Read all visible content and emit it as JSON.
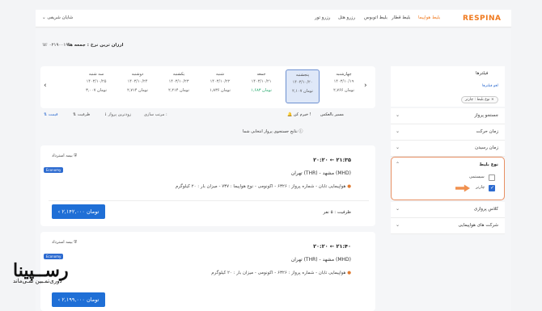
{
  "header": {
    "logo": "RESPINA",
    "nav": [
      "بلیط هواپیما",
      "بلیط قطار",
      "بلیط اتوبوس",
      "رزرو هتل",
      "رزرو تور"
    ],
    "user": "شایان شریفی"
  },
  "route_bar": {
    "title": "ارزان ترین نرخ : جمعه ها",
    "phone": "۰۲۱۹۰۰۱۹۰۰"
  },
  "dates": [
    {
      "day": "چهارشنبه",
      "date": "۱۴۰۳/۱۰/۱۹",
      "price": "۲,۷۶۶ تومان",
      "selected": false,
      "green": false
    },
    {
      "day": "پنجشنبه",
      "date": "۱۴۰۳/۱۰/۲۰",
      "price": "۲,۱۰۷ تومان",
      "selected": true,
      "green": false
    },
    {
      "day": "جمعه",
      "date": "۱۴۰۳/۱۰/۲۱",
      "price": "۱,۶۸۳ تومان",
      "selected": false,
      "green": true
    },
    {
      "day": "شنبه",
      "date": "۱۴۰۳/۱۰/۲۲",
      "price": "۱,۸۳۶ تومان",
      "selected": false,
      "green": false
    },
    {
      "day": "یکشنبه",
      "date": "۱۴۰۳/۱۰/۲۳",
      "price": "۲,۲۱۴ تومان",
      "selected": false,
      "green": false
    },
    {
      "day": "دوشنبه",
      "date": "۱۴۰۳/۱۰/۲۴",
      "price": "۲,۷۱۴ تومان",
      "selected": false,
      "green": false
    },
    {
      "day": "سه شنبه",
      "date": "۱۴۰۳/۱۰/۲۵",
      "price": "۳,۰۰۷ تومان",
      "selected": false,
      "green": false
    }
  ],
  "sidebar": {
    "title": "فیلترها",
    "clear": "لغو فیلترها",
    "chip": "نوع بلیط : چارتر ×",
    "sections": [
      "جستجو پرواز",
      "زمان حرکت",
      "زمان رسیدن"
    ],
    "ticket_type": {
      "label": "نوع بلیط",
      "options": [
        {
          "label": "سیستمی",
          "checked": false
        },
        {
          "label": "چارتر",
          "checked": true
        }
      ]
    },
    "sections_after": [
      "کلاس پروازی",
      "شرکت های هواپیمایی"
    ]
  },
  "sort": {
    "label": "مرتب سازی :",
    "items": [
      "زودترین پرواز",
      "ظرفیت",
      "قیمت"
    ],
    "toggle": "خیرم کن !",
    "reverse": "مسیر بالعکس"
  },
  "info": "نتایج جستجوی پرواز انتخابی شما",
  "cards": [
    {
      "insurance": "بیمه استرداد",
      "badge": "Economy",
      "time": "۲۰:۲۰ ← ۲۱:۳۵",
      "route": "تهران (THR) - مشهد (MHD)",
      "details": "هواپیمایی تابان - شماره پرواز : ۶۳۲۶ - اکونومی - نوع هواپیما : ۷۳۷ - میزان بار : ۲۰ کیلوگرم",
      "capacity": "ظرفیت : ۵ نفر",
      "price": "۲,۱۴۲,۰۰۰ تومان"
    },
    {
      "insurance": "بیمه استرداد",
      "badge": "Economy",
      "time": "۲۰:۲۰ ← ۲۱:۴۰",
      "route": "تهران (THR) - مشهد (MHD)",
      "details": "هواپیمایی تابان - شماره پرواز : ۶۳۲۶ - اکونومی - میزان بار : ۲۰ کیلوگرم",
      "capacity": "",
      "price": "۲,۱۹۹,۰۰۰ تومان"
    }
  ],
  "watermark": {
    "big": "رســپینا",
    "small": "دوری‌تمـبین نمـی‌ماند"
  }
}
